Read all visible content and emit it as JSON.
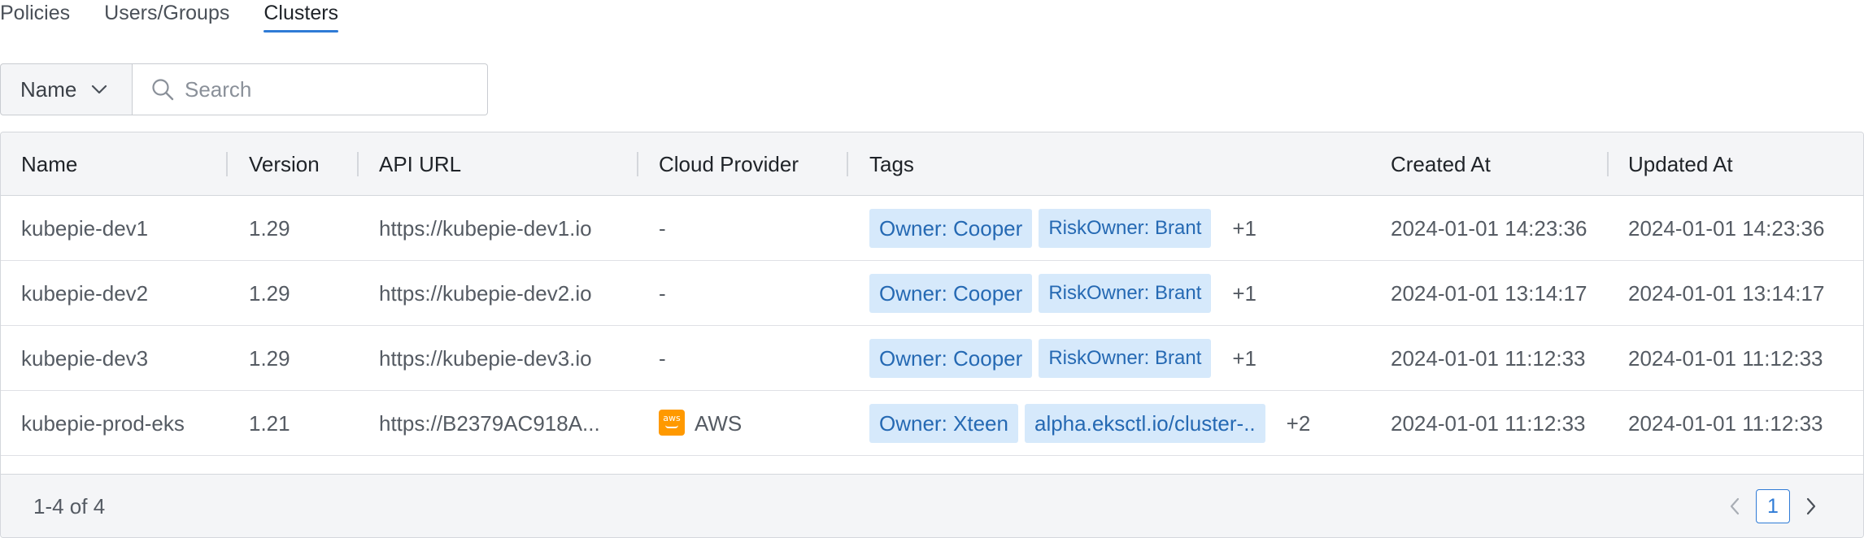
{
  "tabs": [
    {
      "label": "Policies"
    },
    {
      "label": "Users/Groups"
    },
    {
      "label": "Clusters"
    }
  ],
  "search": {
    "field": "Name",
    "placeholder": "Search"
  },
  "table": {
    "columns": [
      "Name",
      "Version",
      "API URL",
      "Cloud Provider",
      "Tags",
      "Created At",
      "Updated At"
    ],
    "rows": [
      {
        "name": "kubepie-dev1",
        "version": "1.29",
        "api_url": "https://kubepie-dev1.io",
        "provider": "-",
        "tag1": "Owner: Cooper",
        "tag2": "RiskOwner: Brant",
        "more": "+1",
        "created": "2024-01-01 14:23:36",
        "updated": "2024-01-01 14:23:36"
      },
      {
        "name": "kubepie-dev2",
        "version": "1.29",
        "api_url": "https://kubepie-dev2.io",
        "provider": "-",
        "tag1": "Owner: Cooper",
        "tag2": "RiskOwner: Brant",
        "more": "+1",
        "created": "2024-01-01 13:14:17",
        "updated": "2024-01-01 13:14:17"
      },
      {
        "name": "kubepie-dev3",
        "version": "1.29",
        "api_url": "https://kubepie-dev3.io",
        "provider": "-",
        "tag1": "Owner: Cooper",
        "tag2": "RiskOwner: Brant",
        "more": "+1",
        "created": "2024-01-01 11:12:33",
        "updated": "2024-01-01 11:12:33"
      },
      {
        "name": "kubepie-prod-eks",
        "version": "1.21",
        "api_url": "https://B2379AC918A...",
        "provider": "AWS",
        "provider_logo": "aws",
        "tag1": "Owner: Xteen",
        "tag2": "alpha.eksctl.io/cluster-..",
        "more": "+2",
        "created": "2024-01-01 11:12:33",
        "updated": "2024-01-01 11:12:33"
      }
    ]
  },
  "pagination": {
    "summary": "1-4 of 4",
    "current_page": "1"
  },
  "colors": {
    "accent": "#2f7bd6",
    "tag_bg": "#d6e9fb",
    "tag_text": "#2569b3",
    "aws": "#ff9900"
  }
}
